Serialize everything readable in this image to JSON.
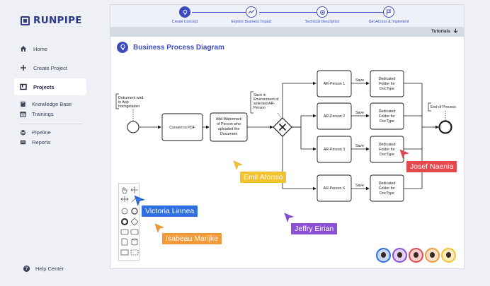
{
  "app": {
    "logo_text": "RUNPIPE"
  },
  "sidebar": {
    "items": [
      {
        "label": "Home",
        "icon": "home-icon"
      },
      {
        "label": "Create Project",
        "icon": "plus-icon"
      },
      {
        "label": "Projects",
        "icon": "projects-icon",
        "active": true
      },
      {
        "label": "Knowledge Base",
        "icon": "book-icon"
      },
      {
        "label": "Trainings",
        "icon": "calendar-icon"
      },
      {
        "label": "Pipeline",
        "icon": "layers-icon"
      },
      {
        "label": "Reports",
        "icon": "report-icon"
      }
    ],
    "help_label": "Help Center"
  },
  "stepper": {
    "steps": [
      {
        "label": "Create Concept",
        "icon": "lightbulb-icon",
        "active": true
      },
      {
        "label": "Explore Business Impact",
        "icon": "chart-line-icon"
      },
      {
        "label": "Technical Description",
        "icon": "gear-icon"
      },
      {
        "label": "Get Access & Implement",
        "icon": "flag-icon"
      }
    ]
  },
  "tutorials_label": "Tutorials",
  "diagram": {
    "title": "Business Process Diagram",
    "annotations": {
      "start": [
        "Dokument wird",
        "in App",
        "hochgeladen"
      ],
      "save_env": [
        "Save in",
        "Environment of",
        "selected AR-",
        "Person"
      ],
      "end": "End of Process"
    },
    "tasks": {
      "convert": "Convert to PDF",
      "watermark": [
        "Add Watermark",
        "of Person who",
        "uploaded the",
        "Document"
      ],
      "persons": [
        "AR-Person 1",
        "AR-Person 2",
        "AR-Person 3",
        "AR-Person X"
      ],
      "folder": [
        "Dedicated",
        "Folder for",
        "DocType"
      ],
      "save_label": "Save"
    }
  },
  "collaborators": [
    {
      "name": "Emil Afonso",
      "color": "#f2c230"
    },
    {
      "name": "Josef Naenia",
      "color": "#e5484d"
    },
    {
      "name": "Victoria Linnea",
      "color": "#2f6fe0"
    },
    {
      "name": "Isabeau Marijke",
      "color": "#f2993a"
    },
    {
      "name": "Jeffry Eirian",
      "color": "#8a4fd6"
    }
  ],
  "avatar_colors": [
    "#2f6fe0",
    "#8a4fd6",
    "#e5484d",
    "#f2993a",
    "#f2c230"
  ]
}
